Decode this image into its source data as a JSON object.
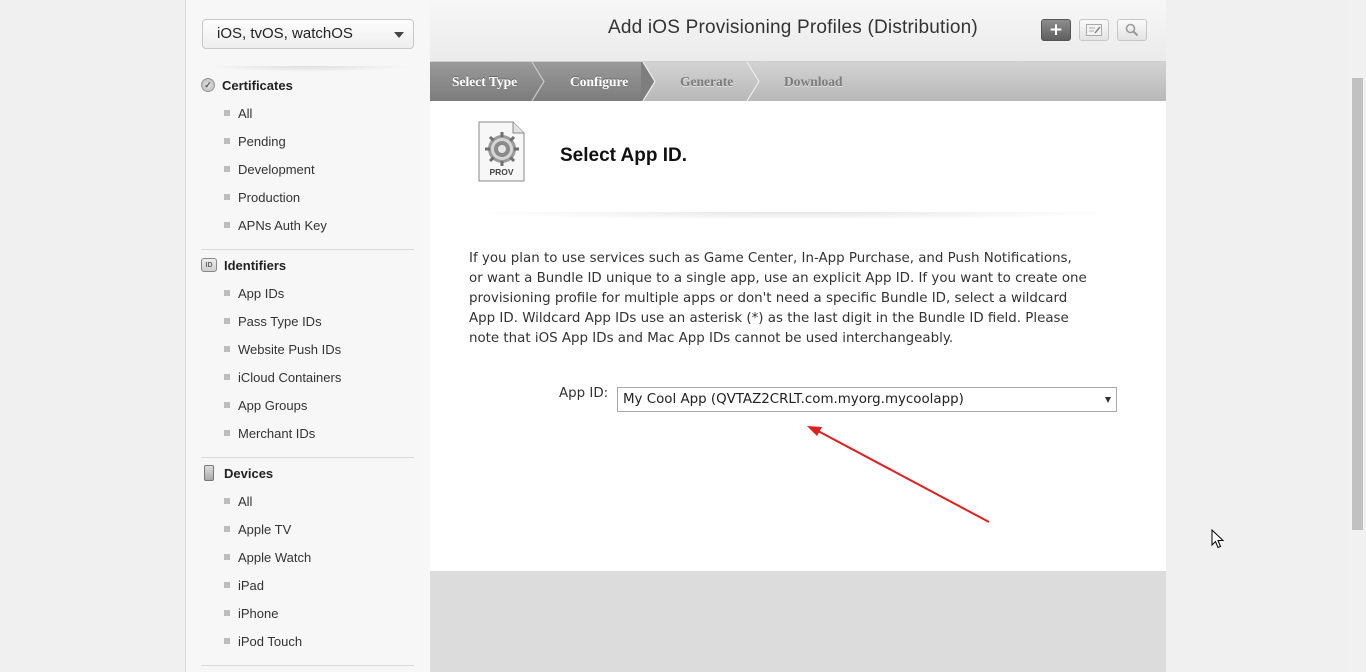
{
  "sidebar": {
    "platform_select": "iOS, tvOS, watchOS",
    "sections": [
      {
        "title": "Certificates",
        "icon": "certificate-icon",
        "items": [
          "All",
          "Pending",
          "Development",
          "Production",
          "APNs Auth Key"
        ]
      },
      {
        "title": "Identifiers",
        "icon": "id-icon",
        "icon_text": "ID",
        "items": [
          "App IDs",
          "Pass Type IDs",
          "Website Push IDs",
          "iCloud Containers",
          "App Groups",
          "Merchant IDs"
        ]
      },
      {
        "title": "Devices",
        "icon": "device-icon",
        "items": [
          "All",
          "Apple TV",
          "Apple Watch",
          "iPad",
          "iPhone",
          "iPod Touch"
        ]
      }
    ]
  },
  "header": {
    "title": "Add iOS Provisioning Profiles (Distribution)",
    "buttons": [
      "add-icon",
      "edit-icon",
      "search-icon"
    ]
  },
  "steps": [
    {
      "label": "Select Type",
      "state": "done"
    },
    {
      "label": "Configure",
      "state": "current"
    },
    {
      "label": "Generate",
      "state": "pending"
    },
    {
      "label": "Download",
      "state": "pending"
    }
  ],
  "content": {
    "icon_label": "PROV",
    "section_title": "Select App ID.",
    "info_text": "If you plan to use services such as Game Center, In-App Purchase, and Push Notifications, or want a Bundle ID unique to a single app, use an explicit App ID. If you want to create one provisioning profile for multiple apps or don't need a specific Bundle ID, select a wildcard App ID. Wildcard App IDs use an asterisk (*) as the last digit in the Bundle ID field. Please note that iOS App IDs and Mac App IDs cannot be used interchangeably.",
    "app_id_label": "App ID:",
    "app_id_value": "My Cool App (QVTAZ2CRLT.com.myorg.mycoolapp)"
  },
  "colors": {
    "annotation_arrow": "#e02020",
    "step_active": "#8a8a8a",
    "step_inactive": "#c4c4c4"
  }
}
